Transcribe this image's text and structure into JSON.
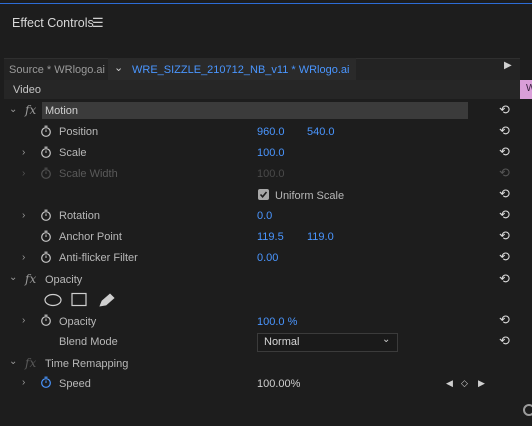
{
  "header": {
    "title": "Effect Controls"
  },
  "tabs": {
    "source": "Source * WRlogo.ai",
    "main": "WRE_SIZZLE_210712_NB_v11 * WRlogo.ai"
  },
  "timeline": {
    "video_label": "Video",
    "clip_label": "W"
  },
  "motion": {
    "name": "Motion",
    "position": {
      "label": "Position",
      "x": "960.0",
      "y": "540.0"
    },
    "scale": {
      "label": "Scale",
      "value": "100.0"
    },
    "scale_width": {
      "label": "Scale Width",
      "value": "100.0"
    },
    "uniform_scale": {
      "label": "Uniform Scale",
      "checked": true
    },
    "rotation": {
      "label": "Rotation",
      "value": "0.0"
    },
    "anchor_point": {
      "label": "Anchor Point",
      "x": "119.5",
      "y": "119.0"
    },
    "anti_flicker": {
      "label": "Anti-flicker Filter",
      "value": "0.00"
    }
  },
  "opacity": {
    "name": "Opacity",
    "opacity": {
      "label": "Opacity",
      "value": "100.0 %"
    },
    "blend_mode": {
      "label": "Blend Mode",
      "value": "Normal"
    }
  },
  "time_remapping": {
    "name": "Time Remapping",
    "speed": {
      "label": "Speed",
      "value": "100.00%"
    }
  },
  "colors": {
    "accent": "#4a96ff",
    "clip": "#d99ed8"
  }
}
